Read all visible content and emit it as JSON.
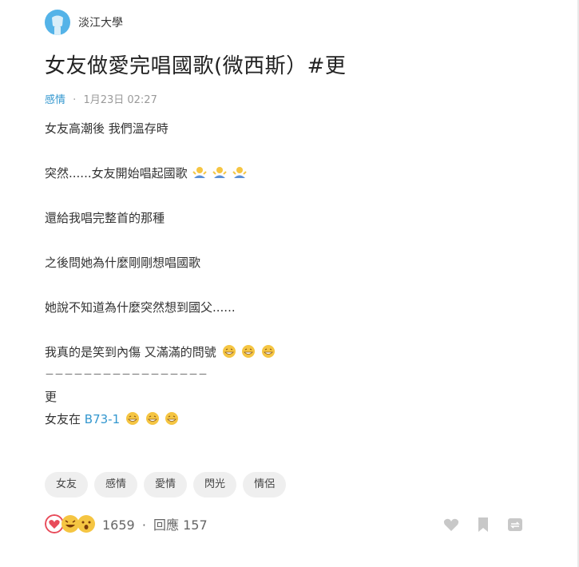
{
  "author": {
    "name": "淡江大學"
  },
  "post": {
    "title": "女友做愛完唱國歌(微西斯）#更",
    "forum": "感情",
    "date": "1月23日 02:27",
    "lines": [
      "女友高潮後  我們溫存時",
      "突然......女友開始唱起國歌",
      "還給我唱完整首的那種",
      "之後問她為什麼剛剛想唱國歌",
      "她說不知道為什麼突然想到國父......",
      "我真的是笑到內傷 又滿滿的問號",
      "－－－－－－－－－－－－－－－－－",
      "更",
      "女友在"
    ],
    "link_text": "B73-1"
  },
  "tags": [
    "女友",
    "感情",
    "愛情",
    "閃光",
    "情侶"
  ],
  "stats": {
    "likes": "1659",
    "reply_label": "回應",
    "replies": "157"
  },
  "colors": {
    "accent": "#3397cf",
    "heart": "#e84b5a"
  },
  "icons": [
    "heart-reaction-icon",
    "laugh-reaction-icon",
    "surprised-reaction-icon",
    "like-heart-icon",
    "bookmark-icon",
    "share-icon"
  ]
}
